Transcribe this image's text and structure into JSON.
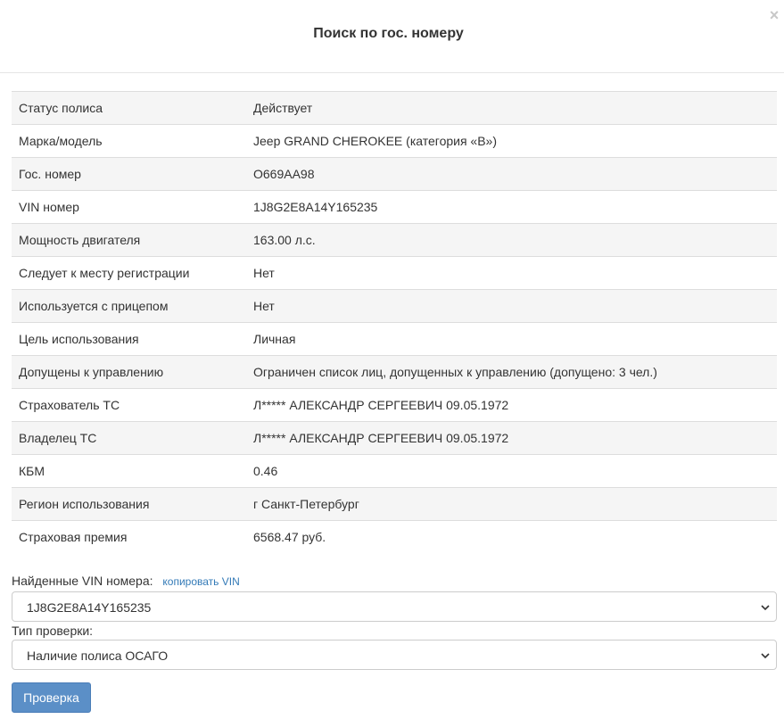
{
  "modal": {
    "title": "Поиск по гос. номеру",
    "close_symbol": "×"
  },
  "details": [
    {
      "label": "Статус полиса",
      "value": "Действует"
    },
    {
      "label": "Марка/модель",
      "value": "Jeep GRAND CHEROKEE (категория «B»)"
    },
    {
      "label": "Гос. номер",
      "value": "О669АА98"
    },
    {
      "label": "VIN номер",
      "value": "1J8G2E8A14Y165235"
    },
    {
      "label": "Мощность двигателя",
      "value": "163.00 л.с."
    },
    {
      "label": "Следует к месту регистрации",
      "value": "Нет"
    },
    {
      "label": "Используется с прицепом",
      "value": "Нет"
    },
    {
      "label": "Цель использования",
      "value": "Личная"
    },
    {
      "label": "Допущены к управлению",
      "value": "Ограничен список лиц, допущенных к управлению (допущено: 3 чел.)"
    },
    {
      "label": "Страхователь ТС",
      "value": "Л***** АЛЕКСАНДР СЕРГЕЕВИЧ 09.05.1972"
    },
    {
      "label": "Владелец ТС",
      "value": "Л***** АЛЕКСАНДР СЕРГЕЕВИЧ 09.05.1972"
    },
    {
      "label": "КБМ",
      "value": "0.46"
    },
    {
      "label": "Регион использования",
      "value": "г Санкт-Петербург"
    },
    {
      "label": "Страховая премия",
      "value": "6568.47 руб."
    }
  ],
  "vin_select": {
    "label": "Найденные VIN номера:",
    "copy_link": "копировать VIN",
    "selected": "1J8G2E8A14Y165235"
  },
  "check_type_select": {
    "label": "Тип проверки:",
    "selected": "Наличие полиса ОСАГО"
  },
  "submit_button": {
    "label": "Проверка"
  },
  "colors": {
    "accent": "#337ab7",
    "button": "#5b8fc7",
    "stripe": "#f5f5f5"
  }
}
